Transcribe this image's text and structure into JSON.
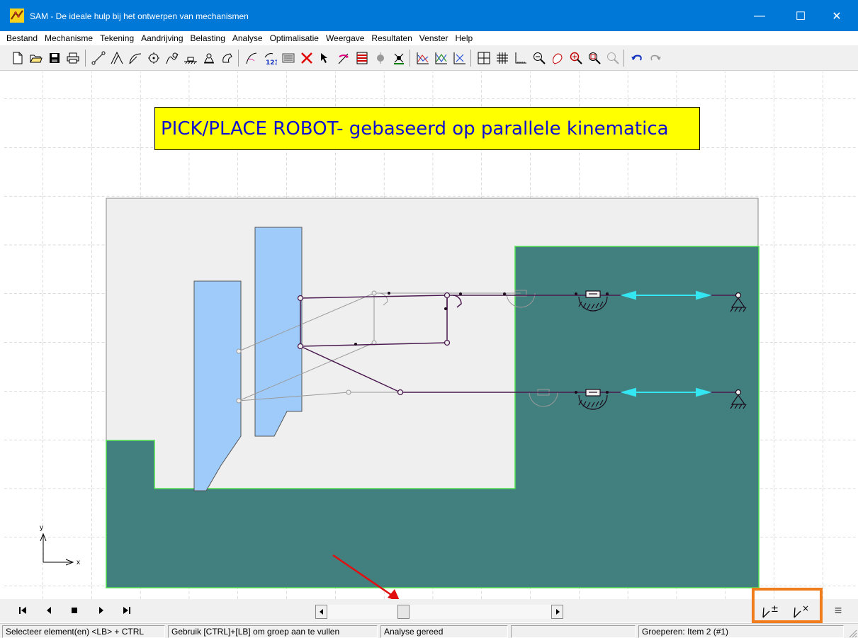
{
  "window": {
    "title": "SAM - De ideale hulp bij het ontwerpen van mechanismen",
    "minimize": "—",
    "maximize": "☐",
    "close": "✕"
  },
  "menu": [
    {
      "label": "Bestand"
    },
    {
      "label": "Mechanisme"
    },
    {
      "label": "Tekening"
    },
    {
      "label": "Aandrijving"
    },
    {
      "label": "Belasting"
    },
    {
      "label": "Analyse"
    },
    {
      "label": "Optimalisatie"
    },
    {
      "label": "Weergave"
    },
    {
      "label": "Resultaten"
    },
    {
      "label": "Venster"
    },
    {
      "label": "Help"
    }
  ],
  "toolbar_icons": [
    "new-file-icon",
    "open-folder-icon",
    "save-icon",
    "print-icon",
    "beam-element-icon",
    "truss-element-icon",
    "arc-element-icon",
    "gear-icon",
    "spring-icon",
    "slider-icon",
    "pulley-icon",
    "joint-icon",
    "path-icon",
    "numbering-icon",
    "properties-icon",
    "delete-icon",
    "select-arrow-icon",
    "input-motion-icon",
    "load-icon",
    "spring-load-icon",
    "mass-icon",
    "graph-icon",
    "graph-multi-icon",
    "graph-clear-icon",
    "grid-icon",
    "grid-snap-icon",
    "axis-icon",
    "zoom-out-icon",
    "zoom-pan-icon",
    "zoom-in-icon",
    "zoom-window-icon",
    "zoom-all-icon",
    "undo-icon",
    "redo-icon"
  ],
  "canvas": {
    "banner": "PICK/PLACE ROBOT- gebaseerd op parallele kinematica",
    "axis_y": "y",
    "axis_x": "x"
  },
  "colors": {
    "titlebar": "#0078d7",
    "banner_bg": "#ffff00",
    "banner_text": "#1010d0",
    "teal_body": "#427f7f",
    "blue_bodies": "#9fcbfa",
    "mechanism": "#4a1a4f",
    "actuator": "#33e6f2",
    "highlight": "#f07c1b",
    "arrow": "#e01010"
  },
  "animation": {
    "scroll_position_fraction": 0.33
  },
  "status": {
    "cell1": "Selecteer element(en) <LB> + CTRL",
    "cell2": "Gebruik [CTRL]+[LB] om groep aan te vullen",
    "cell3": "Analyse gereed",
    "cell4": "",
    "cell5": "Groeperen: Item 2 (#1)"
  }
}
